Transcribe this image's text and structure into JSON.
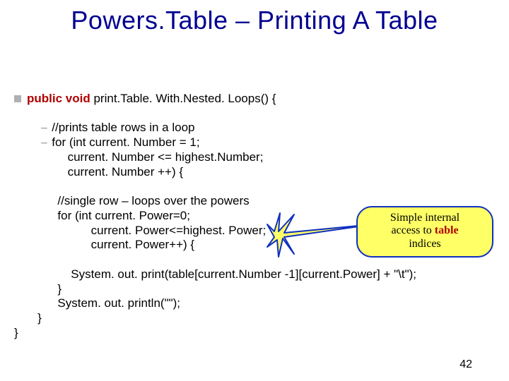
{
  "title": "Powers.Table – Printing A Table",
  "code": {
    "kw_public": "public",
    "kw_void": "void",
    "sig_rest": " print.Table. With.Nested. Loops() {",
    "c1": "//prints table rows in a loop",
    "c2": "for (int current. Number = 1;",
    "c3": "current. Number <= highest.Number;",
    "c4": "current. Number ++) {",
    "c5": "//single row – loops over the powers",
    "c6": "for (int current. Power=0;",
    "c7": "current. Power<=highest. Power;",
    "c8": "current. Power++) {",
    "c9": "System. out. print(table[current.Number -1][current.Power] + \"\\t\");",
    "c10": "}",
    "c11": "System. out. println(\"\");",
    "c12": "}",
    "c13": "}"
  },
  "callout": {
    "line1": "Simple internal",
    "line2_pre": "access to ",
    "line2_tbl": "table",
    "line3": "indices"
  },
  "slide_number": "42"
}
